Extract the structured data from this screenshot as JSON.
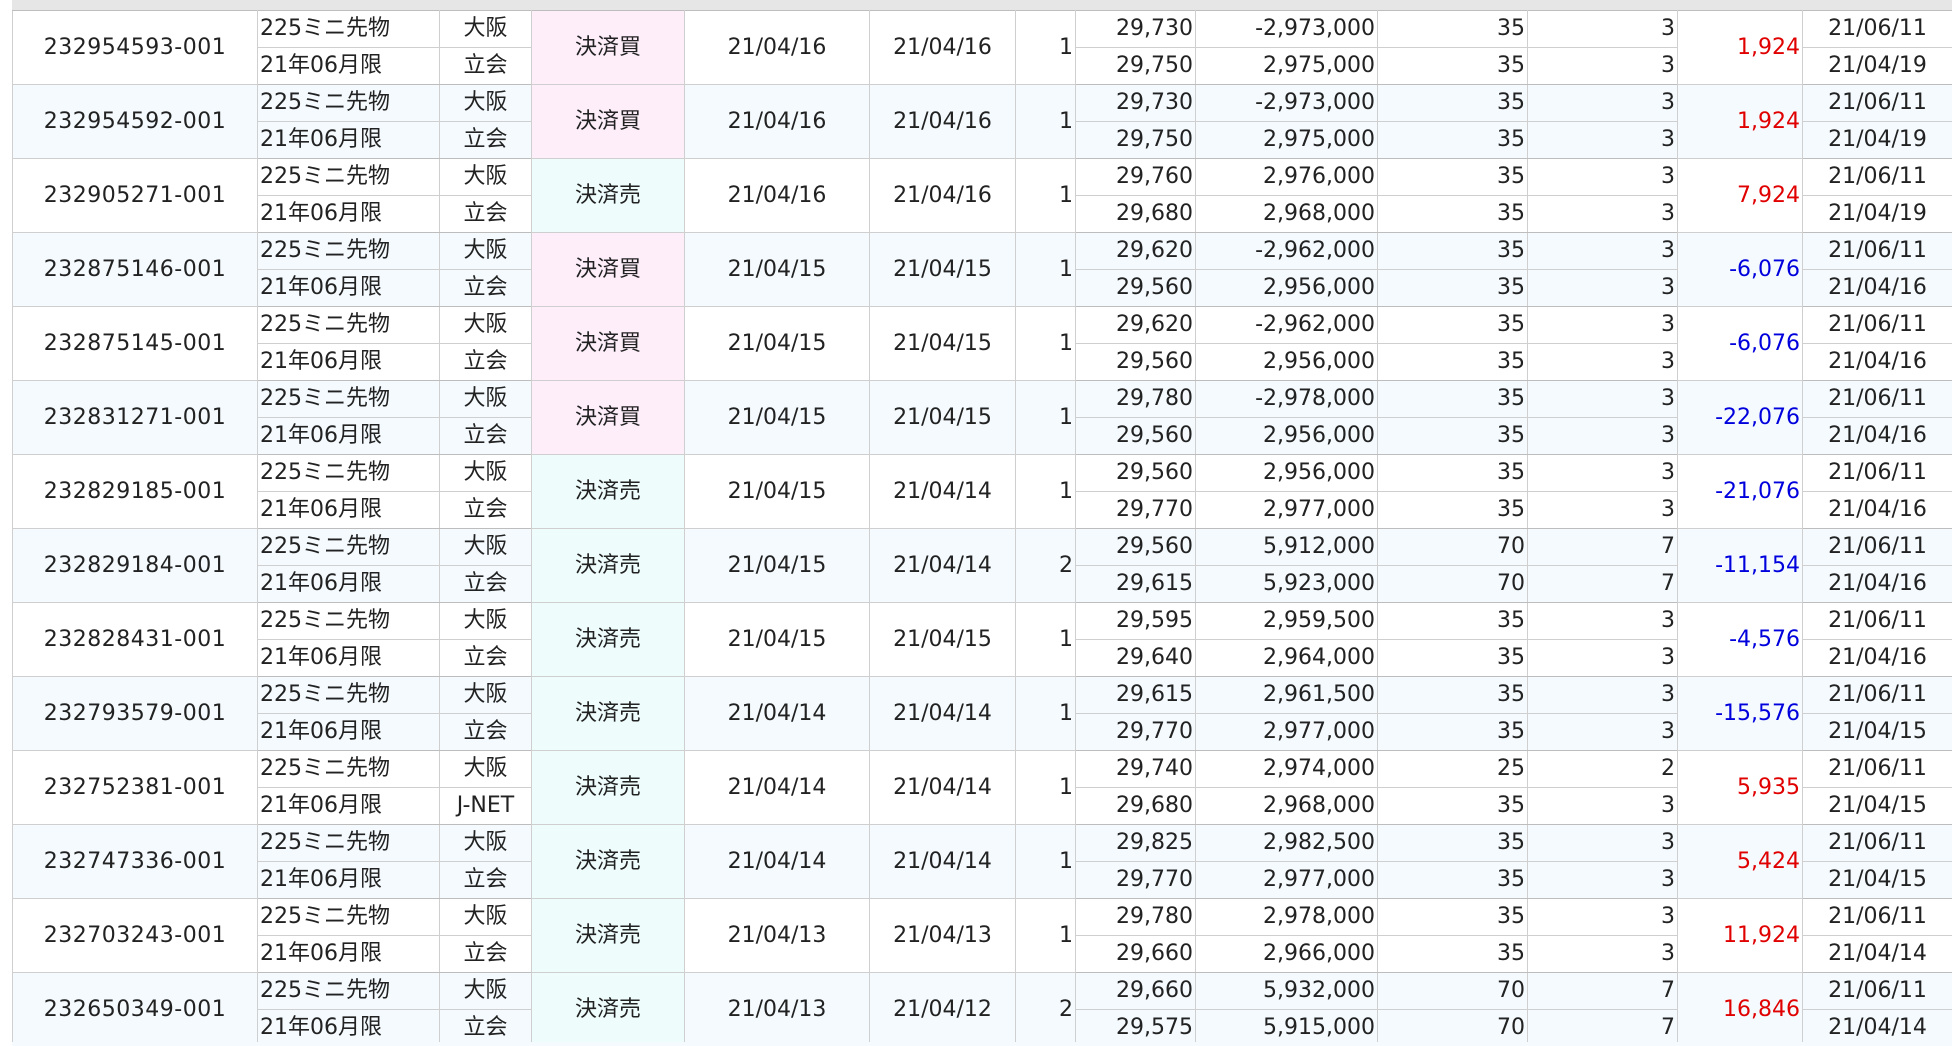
{
  "rows": [
    {
      "trade_id": "232954593-001",
      "product_line1": "225ミニ先物",
      "product_line2": "21年06月限",
      "market_line1": "大阪",
      "market_line2": "立会",
      "kind": "決済買",
      "kind_type": "buy",
      "date1": "21/04/16",
      "date2": "21/04/16",
      "qty": "1",
      "price_line1": "29,730",
      "price_line2": "29,750",
      "amount_line1": "-2,973,000",
      "amount_line2": "2,975,000",
      "fee_line1": "35",
      "fee_line2": "35",
      "tax_line1": "3",
      "tax_line2": "3",
      "profit_loss": "1,924",
      "pl_sign": "pos",
      "end_date_line1": "21/06/11",
      "end_date_line2": "21/04/19"
    },
    {
      "trade_id": "232954592-001",
      "product_line1": "225ミニ先物",
      "product_line2": "21年06月限",
      "market_line1": "大阪",
      "market_line2": "立会",
      "kind": "決済買",
      "kind_type": "buy",
      "date1": "21/04/16",
      "date2": "21/04/16",
      "qty": "1",
      "price_line1": "29,730",
      "price_line2": "29,750",
      "amount_line1": "-2,973,000",
      "amount_line2": "2,975,000",
      "fee_line1": "35",
      "fee_line2": "35",
      "tax_line1": "3",
      "tax_line2": "3",
      "profit_loss": "1,924",
      "pl_sign": "pos",
      "end_date_line1": "21/06/11",
      "end_date_line2": "21/04/19"
    },
    {
      "trade_id": "232905271-001",
      "product_line1": "225ミニ先物",
      "product_line2": "21年06月限",
      "market_line1": "大阪",
      "market_line2": "立会",
      "kind": "決済売",
      "kind_type": "sell",
      "date1": "21/04/16",
      "date2": "21/04/16",
      "qty": "1",
      "price_line1": "29,760",
      "price_line2": "29,680",
      "amount_line1": "2,976,000",
      "amount_line2": "2,968,000",
      "fee_line1": "35",
      "fee_line2": "35",
      "tax_line1": "3",
      "tax_line2": "3",
      "profit_loss": "7,924",
      "pl_sign": "pos",
      "end_date_line1": "21/06/11",
      "end_date_line2": "21/04/19"
    },
    {
      "trade_id": "232875146-001",
      "product_line1": "225ミニ先物",
      "product_line2": "21年06月限",
      "market_line1": "大阪",
      "market_line2": "立会",
      "kind": "決済買",
      "kind_type": "buy",
      "date1": "21/04/15",
      "date2": "21/04/15",
      "qty": "1",
      "price_line1": "29,620",
      "price_line2": "29,560",
      "amount_line1": "-2,962,000",
      "amount_line2": "2,956,000",
      "fee_line1": "35",
      "fee_line2": "35",
      "tax_line1": "3",
      "tax_line2": "3",
      "profit_loss": "-6,076",
      "pl_sign": "neg",
      "end_date_line1": "21/06/11",
      "end_date_line2": "21/04/16"
    },
    {
      "trade_id": "232875145-001",
      "product_line1": "225ミニ先物",
      "product_line2": "21年06月限",
      "market_line1": "大阪",
      "market_line2": "立会",
      "kind": "決済買",
      "kind_type": "buy",
      "date1": "21/04/15",
      "date2": "21/04/15",
      "qty": "1",
      "price_line1": "29,620",
      "price_line2": "29,560",
      "amount_line1": "-2,962,000",
      "amount_line2": "2,956,000",
      "fee_line1": "35",
      "fee_line2": "35",
      "tax_line1": "3",
      "tax_line2": "3",
      "profit_loss": "-6,076",
      "pl_sign": "neg",
      "end_date_line1": "21/06/11",
      "end_date_line2": "21/04/16"
    },
    {
      "trade_id": "232831271-001",
      "product_line1": "225ミニ先物",
      "product_line2": "21年06月限",
      "market_line1": "大阪",
      "market_line2": "立会",
      "kind": "決済買",
      "kind_type": "buy",
      "date1": "21/04/15",
      "date2": "21/04/15",
      "qty": "1",
      "price_line1": "29,780",
      "price_line2": "29,560",
      "amount_line1": "-2,978,000",
      "amount_line2": "2,956,000",
      "fee_line1": "35",
      "fee_line2": "35",
      "tax_line1": "3",
      "tax_line2": "3",
      "profit_loss": "-22,076",
      "pl_sign": "neg",
      "end_date_line1": "21/06/11",
      "end_date_line2": "21/04/16"
    },
    {
      "trade_id": "232829185-001",
      "product_line1": "225ミニ先物",
      "product_line2": "21年06月限",
      "market_line1": "大阪",
      "market_line2": "立会",
      "kind": "決済売",
      "kind_type": "sell",
      "date1": "21/04/15",
      "date2": "21/04/14",
      "qty": "1",
      "price_line1": "29,560",
      "price_line2": "29,770",
      "amount_line1": "2,956,000",
      "amount_line2": "2,977,000",
      "fee_line1": "35",
      "fee_line2": "35",
      "tax_line1": "3",
      "tax_line2": "3",
      "profit_loss": "-21,076",
      "pl_sign": "neg",
      "end_date_line1": "21/06/11",
      "end_date_line2": "21/04/16"
    },
    {
      "trade_id": "232829184-001",
      "product_line1": "225ミニ先物",
      "product_line2": "21年06月限",
      "market_line1": "大阪",
      "market_line2": "立会",
      "kind": "決済売",
      "kind_type": "sell",
      "date1": "21/04/15",
      "date2": "21/04/14",
      "qty": "2",
      "price_line1": "29,560",
      "price_line2": "29,615",
      "amount_line1": "5,912,000",
      "amount_line2": "5,923,000",
      "fee_line1": "70",
      "fee_line2": "70",
      "tax_line1": "7",
      "tax_line2": "7",
      "profit_loss": "-11,154",
      "pl_sign": "neg",
      "end_date_line1": "21/06/11",
      "end_date_line2": "21/04/16"
    },
    {
      "trade_id": "232828431-001",
      "product_line1": "225ミニ先物",
      "product_line2": "21年06月限",
      "market_line1": "大阪",
      "market_line2": "立会",
      "kind": "決済売",
      "kind_type": "sell",
      "date1": "21/04/15",
      "date2": "21/04/15",
      "qty": "1",
      "price_line1": "29,595",
      "price_line2": "29,640",
      "amount_line1": "2,959,500",
      "amount_line2": "2,964,000",
      "fee_line1": "35",
      "fee_line2": "35",
      "tax_line1": "3",
      "tax_line2": "3",
      "profit_loss": "-4,576",
      "pl_sign": "neg",
      "end_date_line1": "21/06/11",
      "end_date_line2": "21/04/16"
    },
    {
      "trade_id": "232793579-001",
      "product_line1": "225ミニ先物",
      "product_line2": "21年06月限",
      "market_line1": "大阪",
      "market_line2": "立会",
      "kind": "決済売",
      "kind_type": "sell",
      "date1": "21/04/14",
      "date2": "21/04/14",
      "qty": "1",
      "price_line1": "29,615",
      "price_line2": "29,770",
      "amount_line1": "2,961,500",
      "amount_line2": "2,977,000",
      "fee_line1": "35",
      "fee_line2": "35",
      "tax_line1": "3",
      "tax_line2": "3",
      "profit_loss": "-15,576",
      "pl_sign": "neg",
      "end_date_line1": "21/06/11",
      "end_date_line2": "21/04/15"
    },
    {
      "trade_id": "232752381-001",
      "product_line1": "225ミニ先物",
      "product_line2": "21年06月限",
      "market_line1": "大阪",
      "market_line2": "J-NET",
      "kind": "決済売",
      "kind_type": "sell",
      "date1": "21/04/14",
      "date2": "21/04/14",
      "qty": "1",
      "price_line1": "29,740",
      "price_line2": "29,680",
      "amount_line1": "2,974,000",
      "amount_line2": "2,968,000",
      "fee_line1": "25",
      "fee_line2": "35",
      "tax_line1": "2",
      "tax_line2": "3",
      "profit_loss": "5,935",
      "pl_sign": "pos",
      "end_date_line1": "21/06/11",
      "end_date_line2": "21/04/15"
    },
    {
      "trade_id": "232747336-001",
      "product_line1": "225ミニ先物",
      "product_line2": "21年06月限",
      "market_line1": "大阪",
      "market_line2": "立会",
      "kind": "決済売",
      "kind_type": "sell",
      "date1": "21/04/14",
      "date2": "21/04/14",
      "qty": "1",
      "price_line1": "29,825",
      "price_line2": "29,770",
      "amount_line1": "2,982,500",
      "amount_line2": "2,977,000",
      "fee_line1": "35",
      "fee_line2": "35",
      "tax_line1": "3",
      "tax_line2": "3",
      "profit_loss": "5,424",
      "pl_sign": "pos",
      "end_date_line1": "21/06/11",
      "end_date_line2": "21/04/15"
    },
    {
      "trade_id": "232703243-001",
      "product_line1": "225ミニ先物",
      "product_line2": "21年06月限",
      "market_line1": "大阪",
      "market_line2": "立会",
      "kind": "決済売",
      "kind_type": "sell",
      "date1": "21/04/13",
      "date2": "21/04/13",
      "qty": "1",
      "price_line1": "29,780",
      "price_line2": "29,660",
      "amount_line1": "2,978,000",
      "amount_line2": "2,966,000",
      "fee_line1": "35",
      "fee_line2": "35",
      "tax_line1": "3",
      "tax_line2": "3",
      "profit_loss": "11,924",
      "pl_sign": "pos",
      "end_date_line1": "21/06/11",
      "end_date_line2": "21/04/14"
    },
    {
      "trade_id": "232650349-001",
      "product_line1": "225ミニ先物",
      "product_line2": "21年06月限",
      "market_line1": "大阪",
      "market_line2": "立会",
      "kind": "決済売",
      "kind_type": "sell",
      "date1": "21/04/13",
      "date2": "21/04/12",
      "qty": "2",
      "price_line1": "29,660",
      "price_line2": "29,575",
      "amount_line1": "5,932,000",
      "amount_line2": "5,915,000",
      "fee_line1": "70",
      "fee_line2": "70",
      "tax_line1": "7",
      "tax_line2": "7",
      "profit_loss": "16,846",
      "pl_sign": "pos",
      "end_date_line1": "21/06/11",
      "end_date_line2": "21/04/14"
    }
  ],
  "colors": {
    "profit": "#e00000",
    "loss": "#0000dd",
    "buy_bg": "#fdeefa",
    "sell_bg": "#eefcfc",
    "alt_row_bg": "#f4fafd"
  }
}
